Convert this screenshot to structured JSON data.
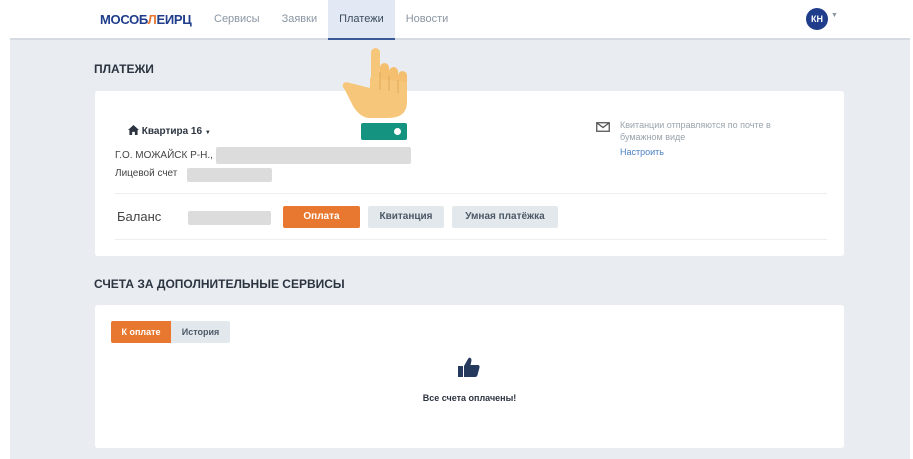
{
  "header": {
    "logo_part1": "МОСОБ",
    "logo_part2": "Л",
    "logo_part3": "ЕИРЦ",
    "nav": [
      {
        "label": "Сервисы"
      },
      {
        "label": "Заявки"
      },
      {
        "label": "Платежи"
      },
      {
        "label": "Новости"
      }
    ],
    "active_nav": "Платежи",
    "avatar_initials": "КН"
  },
  "payments": {
    "section_title": "ПЛАТЕЖИ",
    "flat_label": "Квартира 16",
    "address_prefix": "Г.О. МОЖАЙСК Р-Н.,",
    "account_prefix": "Лицевой счет",
    "notice_text": "Квитанции отправляются по почте в бумажном виде",
    "notice_link": "Настроить",
    "balance_label": "Баланс",
    "buttons": {
      "pay": "Оплата",
      "receipt": "Квитанция",
      "smart": "Умная платёжка"
    }
  },
  "extra": {
    "section_title": "СЧЕТА ЗА ДОПОЛНИТЕЛЬНЫЕ СЕРВИСЫ",
    "tabs": [
      {
        "label": "К оплате"
      },
      {
        "label": "История"
      }
    ],
    "active_tab": "К оплате",
    "status_text": "Все счета оплачены!"
  },
  "colors": {
    "brand_blue": "#1f3d8a",
    "brand_orange": "#e8782f",
    "toggle_green": "#149480",
    "background": "#e9edf2"
  },
  "icons": [
    "home-icon",
    "caret-down-icon",
    "mail-icon",
    "thumbs-up-icon",
    "pointing-hand-icon"
  ]
}
